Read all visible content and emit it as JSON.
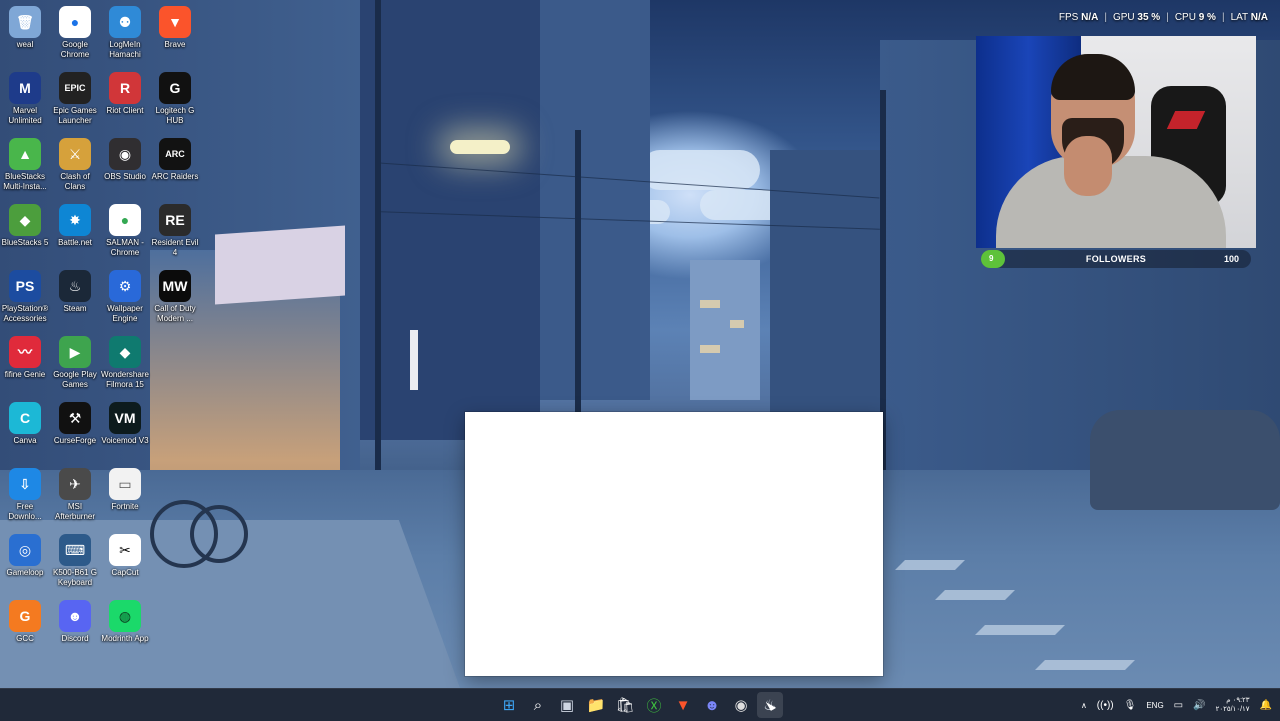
{
  "desktop": {
    "icons": [
      {
        "id": "recycle",
        "label": "weal",
        "glyph": "🗑",
        "bg": "#7fa7d6",
        "col": 0,
        "row": 0
      },
      {
        "id": "chrome",
        "label": "Google Chrome",
        "glyph": "●",
        "bg": "#ffffff",
        "fg": "#1a73e8",
        "col": 1,
        "row": 0
      },
      {
        "id": "hamachi",
        "label": "LogMeIn Hamachi",
        "glyph": "⚉",
        "bg": "#2f8ad7",
        "col": 2,
        "row": 0
      },
      {
        "id": "brave",
        "label": "Brave",
        "glyph": "▼",
        "bg": "#fb542b",
        "col": 3,
        "row": 0
      },
      {
        "id": "marvel",
        "label": "Marvel Unlimited",
        "glyph": "M",
        "bg": "#1e3b8a",
        "col": 0,
        "row": 1
      },
      {
        "id": "epic",
        "label": "Epic Games Launcher",
        "glyph": "EPIC",
        "bg": "#222222",
        "col": 1,
        "row": 1
      },
      {
        "id": "riot",
        "label": "Riot Client",
        "glyph": "R",
        "bg": "#d13639",
        "col": 2,
        "row": 1
      },
      {
        "id": "logitech",
        "label": "Logitech G HUB",
        "glyph": "G",
        "bg": "#111111",
        "col": 3,
        "row": 1
      },
      {
        "id": "bluestacks-multi",
        "label": "BlueStacks Multi-Insta...",
        "glyph": "▲",
        "bg": "#49b64b",
        "col": 0,
        "row": 2
      },
      {
        "id": "coc",
        "label": "Clash of Clans",
        "glyph": "⚔",
        "bg": "#d6a13b",
        "col": 1,
        "row": 2
      },
      {
        "id": "obs",
        "label": "OBS Studio",
        "glyph": "◉",
        "bg": "#302e31",
        "col": 2,
        "row": 2
      },
      {
        "id": "arc",
        "label": "ARC Raiders",
        "glyph": "ARC",
        "bg": "#121212",
        "col": 3,
        "row": 2
      },
      {
        "id": "bluestacks5",
        "label": "BlueStacks 5",
        "glyph": "◆",
        "bg": "#4c9e3d",
        "col": 0,
        "row": 3
      },
      {
        "id": "battlenet",
        "label": "Battle.net",
        "glyph": "✸",
        "bg": "#0e86d4",
        "col": 1,
        "row": 3
      },
      {
        "id": "salman",
        "label": "SALMAN - Chrome",
        "glyph": "●",
        "bg": "#ffffff",
        "fg": "#34a853",
        "col": 2,
        "row": 3
      },
      {
        "id": "re4",
        "label": "Resident Evil 4",
        "glyph": "RE",
        "bg": "#2b2b2b",
        "col": 3,
        "row": 3
      },
      {
        "id": "psacc",
        "label": "PlayStation® Accessories",
        "glyph": "PS",
        "bg": "#1c4ca0",
        "col": 0,
        "row": 4
      },
      {
        "id": "steam",
        "label": "Steam",
        "glyph": "♨",
        "bg": "#1b2838",
        "col": 1,
        "row": 4
      },
      {
        "id": "wallpaper",
        "label": "Wallpaper Engine",
        "glyph": "⚙",
        "bg": "#2969d9",
        "col": 2,
        "row": 4
      },
      {
        "id": "cod",
        "label": "Call of Duty Modern ...",
        "glyph": "MW",
        "bg": "#0b0b0b",
        "col": 3,
        "row": 4
      },
      {
        "id": "fifine",
        "label": "fifine Genie",
        "glyph": "〰",
        "bg": "#e02a3b",
        "col": 0,
        "row": 5
      },
      {
        "id": "gplay",
        "label": "Google Play Games",
        "glyph": "▶",
        "bg": "#3ea44e",
        "col": 1,
        "row": 5
      },
      {
        "id": "filmora",
        "label": "Wondershare Filmora 15",
        "glyph": "◆",
        "bg": "#0f7a6f",
        "col": 2,
        "row": 5
      },
      {
        "id": "canva",
        "label": "Canva",
        "glyph": "C",
        "bg": "#1cb8d6",
        "col": 0,
        "row": 6
      },
      {
        "id": "curseforge",
        "label": "CurseForge",
        "glyph": "⚒",
        "bg": "#111111",
        "col": 1,
        "row": 6
      },
      {
        "id": "voicemod",
        "label": "Voicemod V3",
        "glyph": "VM",
        "bg": "#0d1b1d",
        "col": 2,
        "row": 6
      },
      {
        "id": "freedl",
        "label": "Free Downlo...",
        "glyph": "⇩",
        "bg": "#1e88e5",
        "col": 0,
        "row": 7
      },
      {
        "id": "msi",
        "label": "MSI Afterburner",
        "glyph": "✈",
        "bg": "#4a4a4a",
        "col": 1,
        "row": 7
      },
      {
        "id": "fortnite",
        "label": "Fortnite",
        "glyph": "▭",
        "bg": "#f2f2f2",
        "fg": "#555555",
        "col": 2,
        "row": 7
      },
      {
        "id": "gameloop",
        "label": "Gameloop",
        "glyph": "◎",
        "bg": "#2a6fd1",
        "col": 0,
        "row": 8
      },
      {
        "id": "k500",
        "label": "K500-B61 G Keyboard",
        "glyph": "⌨",
        "bg": "#2d5a8a",
        "col": 1,
        "row": 8
      },
      {
        "id": "capcut",
        "label": "CapCut",
        "glyph": "✂",
        "bg": "#ffffff",
        "fg": "#000000",
        "col": 2,
        "row": 8
      },
      {
        "id": "gcc",
        "label": "GCC",
        "glyph": "G",
        "bg": "#f47a20",
        "col": 0,
        "row": 9
      },
      {
        "id": "discord",
        "label": "Discord",
        "glyph": "☻",
        "bg": "#5865f2",
        "col": 1,
        "row": 9
      },
      {
        "id": "modrinth",
        "label": "Modrinth App",
        "glyph": "◍",
        "bg": "#1bd96a",
        "fg": "#0b3d1f",
        "col": 2,
        "row": 9
      }
    ]
  },
  "overlay": {
    "fps_label": "FPS",
    "fps_value": "N/A",
    "gpu_label": "GPU",
    "gpu_value": "35 %",
    "cpu_label": "CPU",
    "cpu_value": "9 %",
    "lat_label": "LAT",
    "lat_value": "N/A"
  },
  "followers": {
    "current": "9",
    "title": "FOLLOWERS",
    "goal": "100",
    "progress_fraction": 0.09,
    "bar_color": "#5ec23a"
  },
  "taskbar": {
    "apps": [
      {
        "name": "start-button",
        "glyph": "⊞",
        "color": "#3da5f4"
      },
      {
        "name": "search-button",
        "glyph": "⌕",
        "color": "#ffffff"
      },
      {
        "name": "task-view-button",
        "glyph": "▣",
        "color": "#cfd6e3"
      },
      {
        "name": "file-explorer-button",
        "glyph": "📁",
        "color": "#f5c542"
      },
      {
        "name": "store-button",
        "glyph": "🛍",
        "color": "#ffffff"
      },
      {
        "name": "xbox-button",
        "glyph": "Ⓧ",
        "color": "#3fbf3f"
      },
      {
        "name": "brave-taskbar-button",
        "glyph": "▼",
        "color": "#fb542b"
      },
      {
        "name": "discord-taskbar-button",
        "glyph": "☻",
        "color": "#7b86f8"
      },
      {
        "name": "obs-taskbar-button",
        "glyph": "◉",
        "color": "#dddddd"
      },
      {
        "name": "steam-taskbar-button",
        "glyph": "♨",
        "color": "#dfe6f0"
      }
    ],
    "tray": {
      "chevron": "∧",
      "lang": "ENG",
      "time": "٠٩:٢٣ م",
      "date": "٢٠٢٥/١٠/١٧"
    }
  }
}
